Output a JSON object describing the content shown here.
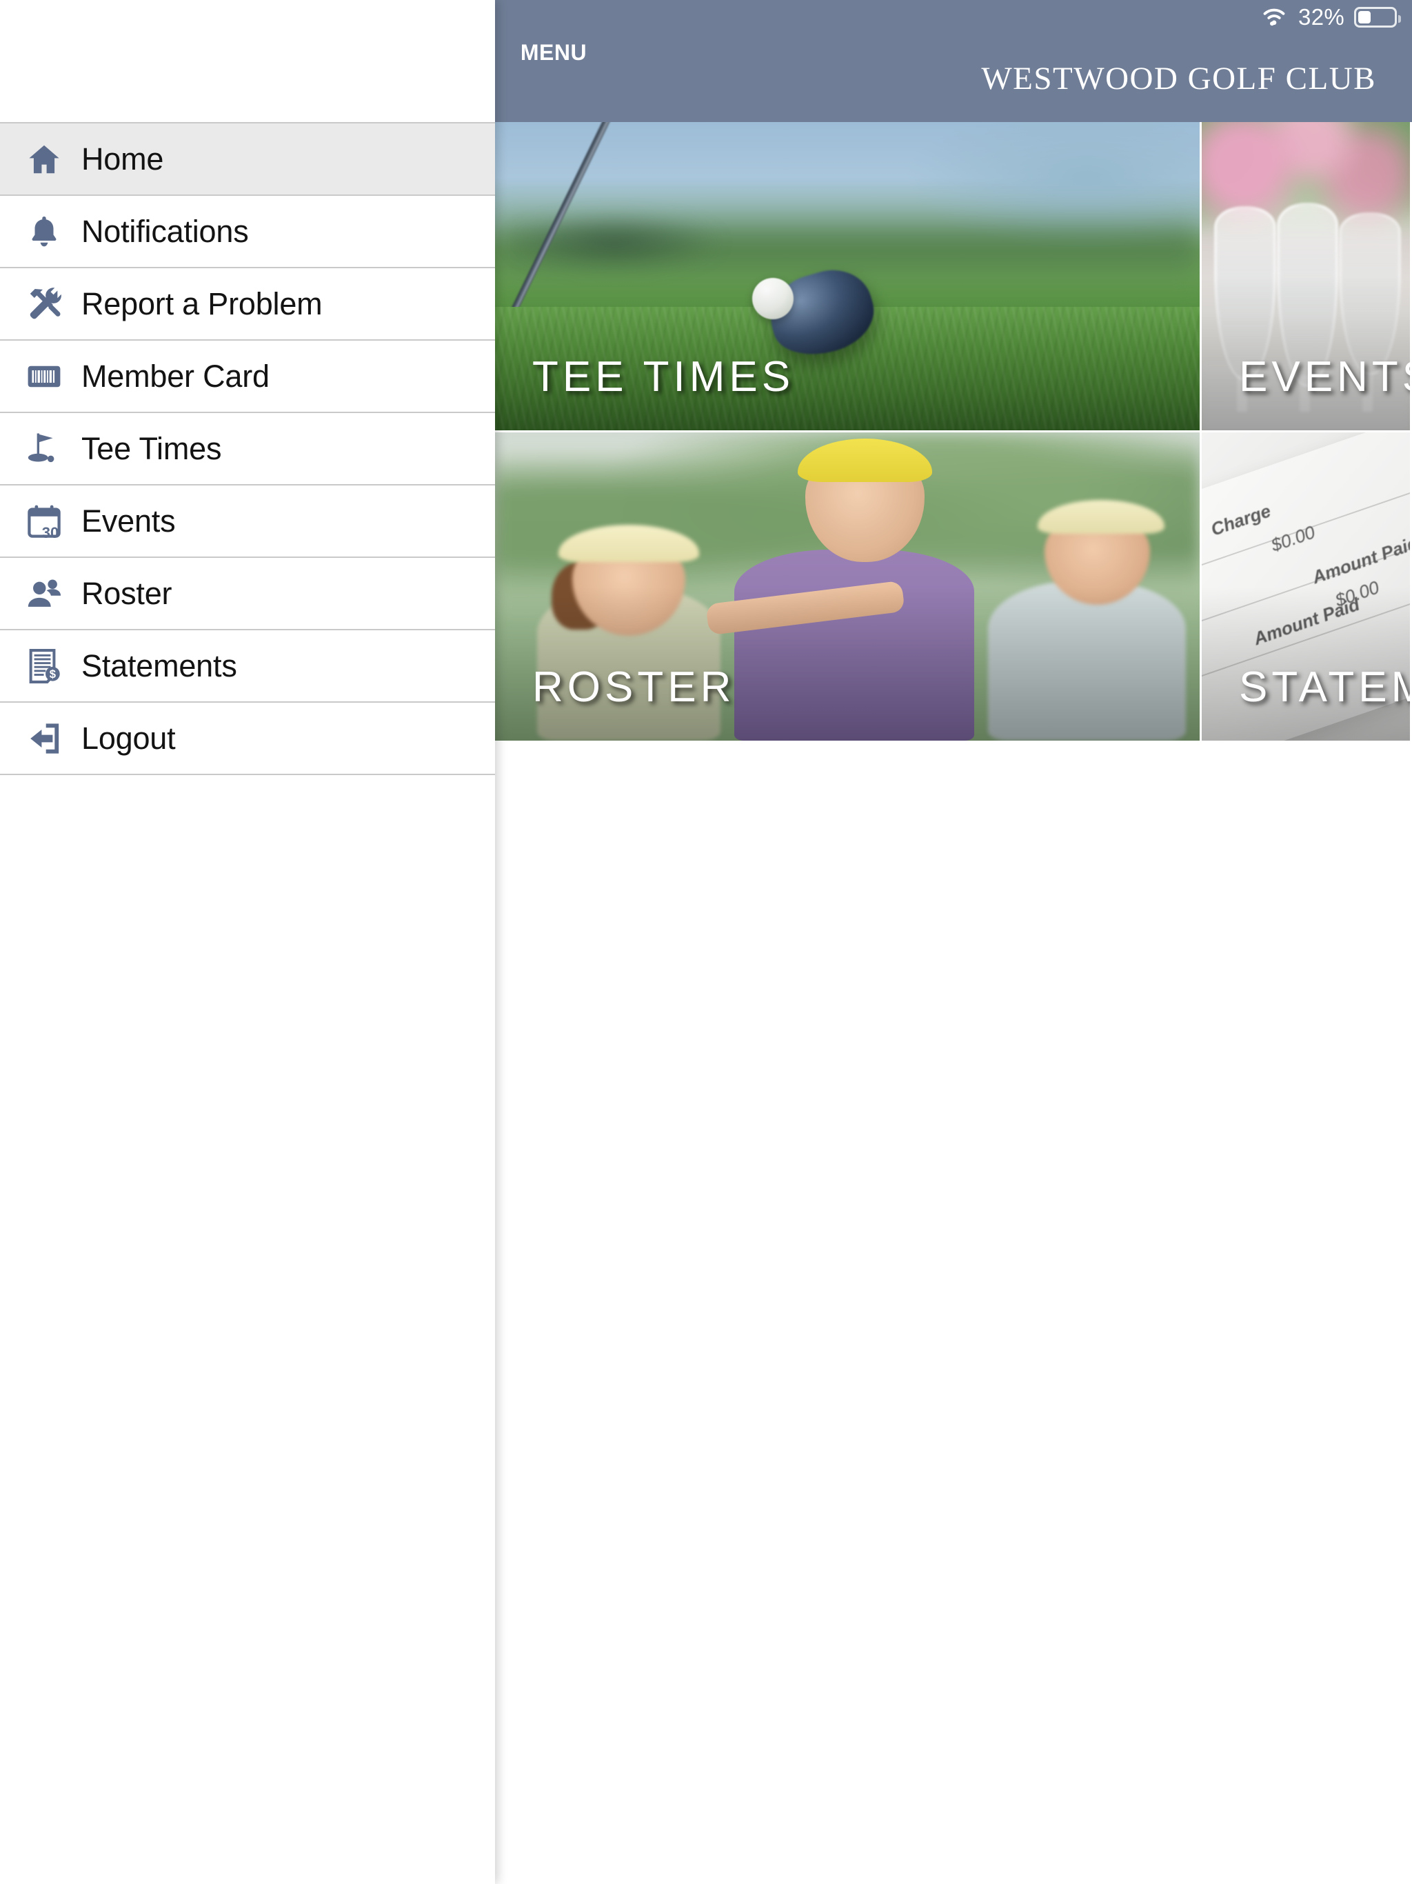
{
  "status_bar": {
    "wifi_icon": "wifi-icon",
    "battery_percent": "32%",
    "battery_level": 32,
    "battery_icon": "battery-icon"
  },
  "header": {
    "menu_button_label": "MENU",
    "menu_icon": "hamburger-menu-icon",
    "club_title": "WESTWOOD GOLF CLUB",
    "background_color": "#6f7d96"
  },
  "sidebar": {
    "items": [
      {
        "label": "Home",
        "icon": "home-icon",
        "active": true
      },
      {
        "label": "Notifications",
        "icon": "bell-icon",
        "active": false
      },
      {
        "label": "Report a Problem",
        "icon": "tools-icon",
        "active": false
      },
      {
        "label": "Member Card",
        "icon": "barcode-icon",
        "active": false
      },
      {
        "label": "Tee Times",
        "icon": "golf-flag-icon",
        "active": false
      },
      {
        "label": "Events",
        "icon": "calendar-icon",
        "active": false
      },
      {
        "label": "Roster",
        "icon": "people-icon",
        "active": false
      },
      {
        "label": "Statements",
        "icon": "document-dollar-icon",
        "active": false
      },
      {
        "label": "Logout",
        "icon": "logout-icon",
        "active": false
      }
    ],
    "active_background": "#eaeaea",
    "icon_color": "#5b6b8c",
    "calendar_day": "30"
  },
  "tiles": [
    {
      "label": "TEE TIMES",
      "art": "golf-driver-ball-on-grass"
    },
    {
      "label": "EVENTS",
      "art": "wine-glasses-with-flowers"
    },
    {
      "label": "ROSTER",
      "art": "three-smiling-golfers"
    },
    {
      "label": "STATEMENTS",
      "art": "billing-statement-paper"
    }
  ],
  "statement_art_text": {
    "charge": "Charge",
    "amount_paid_1": "Amount Paid",
    "amount_paid_2": "Amount Paid",
    "value_1": "$0.00",
    "value_2": "$0.00"
  }
}
